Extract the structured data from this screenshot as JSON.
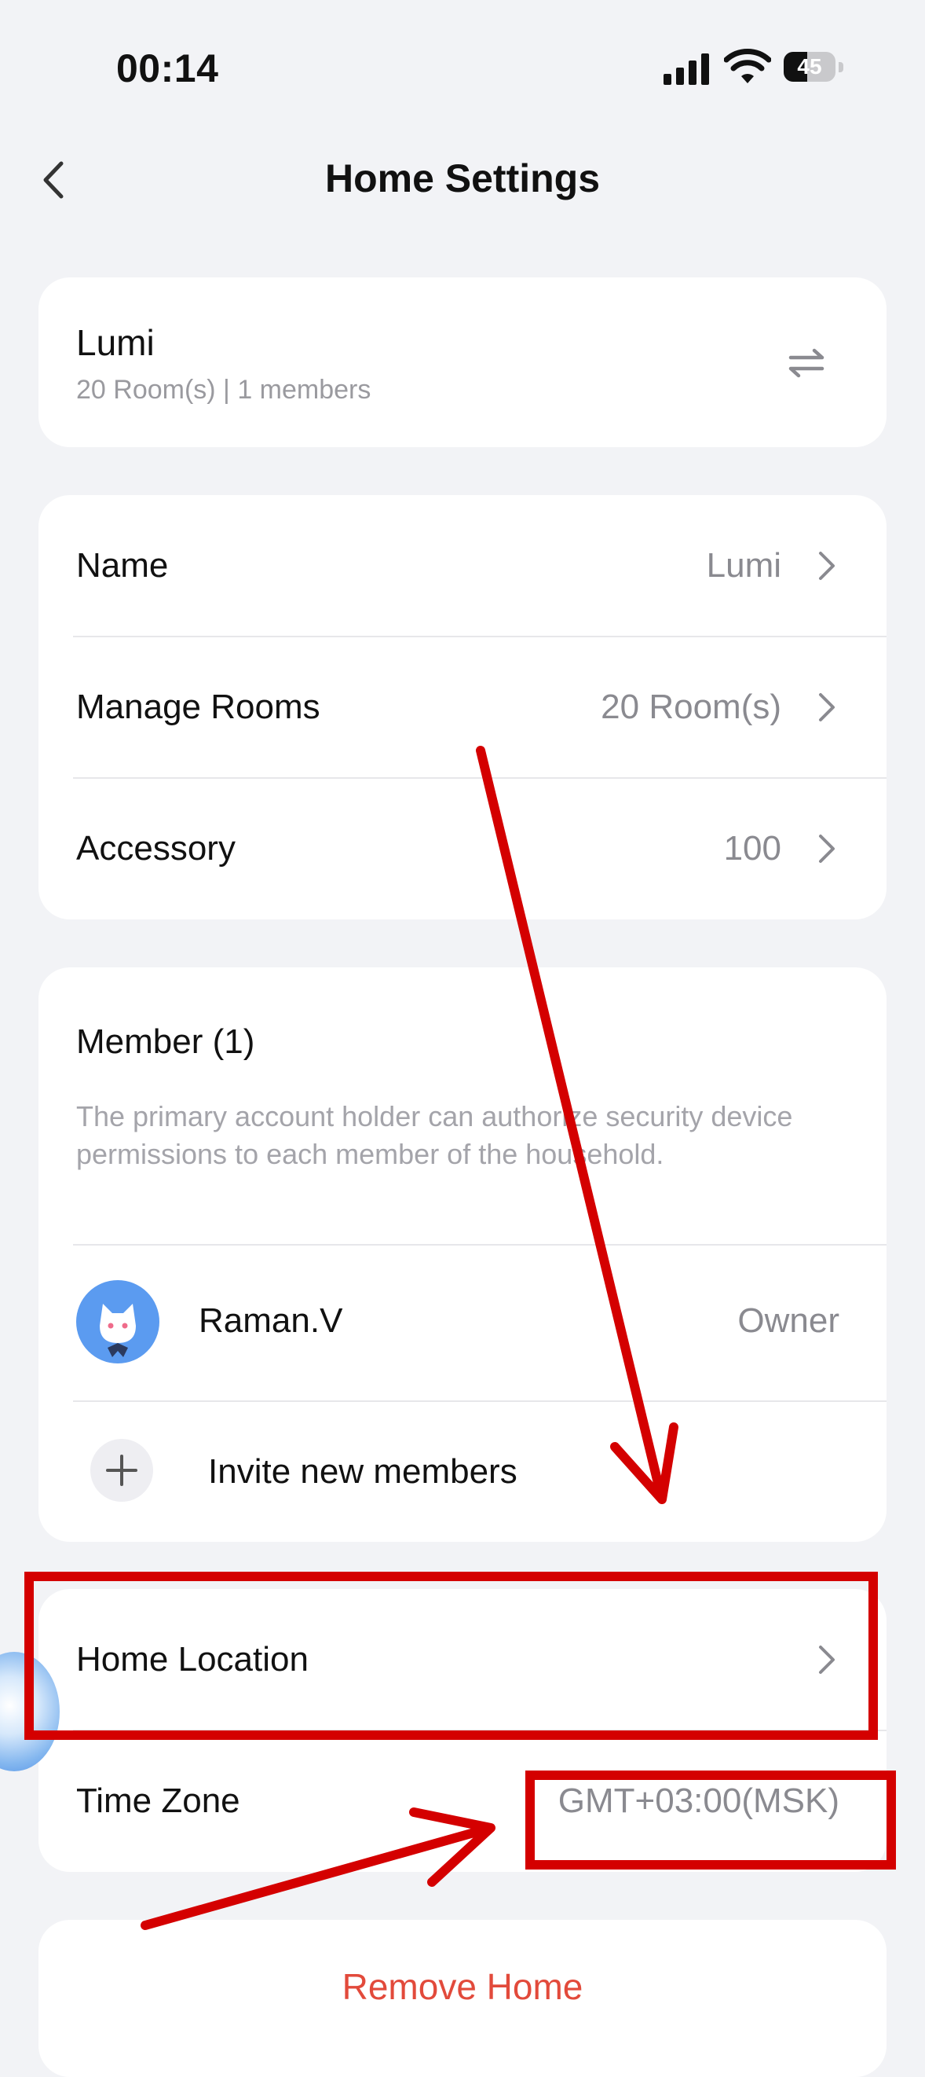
{
  "status_bar": {
    "time": "00:14",
    "battery_level": "45",
    "battery_fraction": 0.45
  },
  "header": {
    "title": "Home Settings",
    "back_icon": "chevron-left-icon"
  },
  "home_card": {
    "name": "Lumi",
    "meta": "20 Room(s) | 1 members",
    "switch_icon": "swap-arrows-icon"
  },
  "settings": {
    "rows": [
      {
        "label": "Name",
        "value": "Lumi"
      },
      {
        "label": "Manage Rooms",
        "value": "20 Room(s)"
      },
      {
        "label": "Accessory",
        "value": "100"
      }
    ]
  },
  "members": {
    "title": "Member (1)",
    "description": "The primary account holder can authorize security device permissions to each member of the household.",
    "list": [
      {
        "name": "Raman.V",
        "role": "Owner"
      }
    ],
    "invite_label": "Invite new members"
  },
  "location": {
    "home_location_label": "Home Location",
    "home_location_value": "",
    "time_zone_label": "Time Zone",
    "time_zone_value": "GMT+03:00(MSK)"
  },
  "footer": {
    "remove_label": "Remove Home"
  },
  "colors": {
    "annotation": "#d40000",
    "danger": "#e24a3b",
    "accent": "#5b9bf0",
    "background": "#f2f3f6"
  }
}
